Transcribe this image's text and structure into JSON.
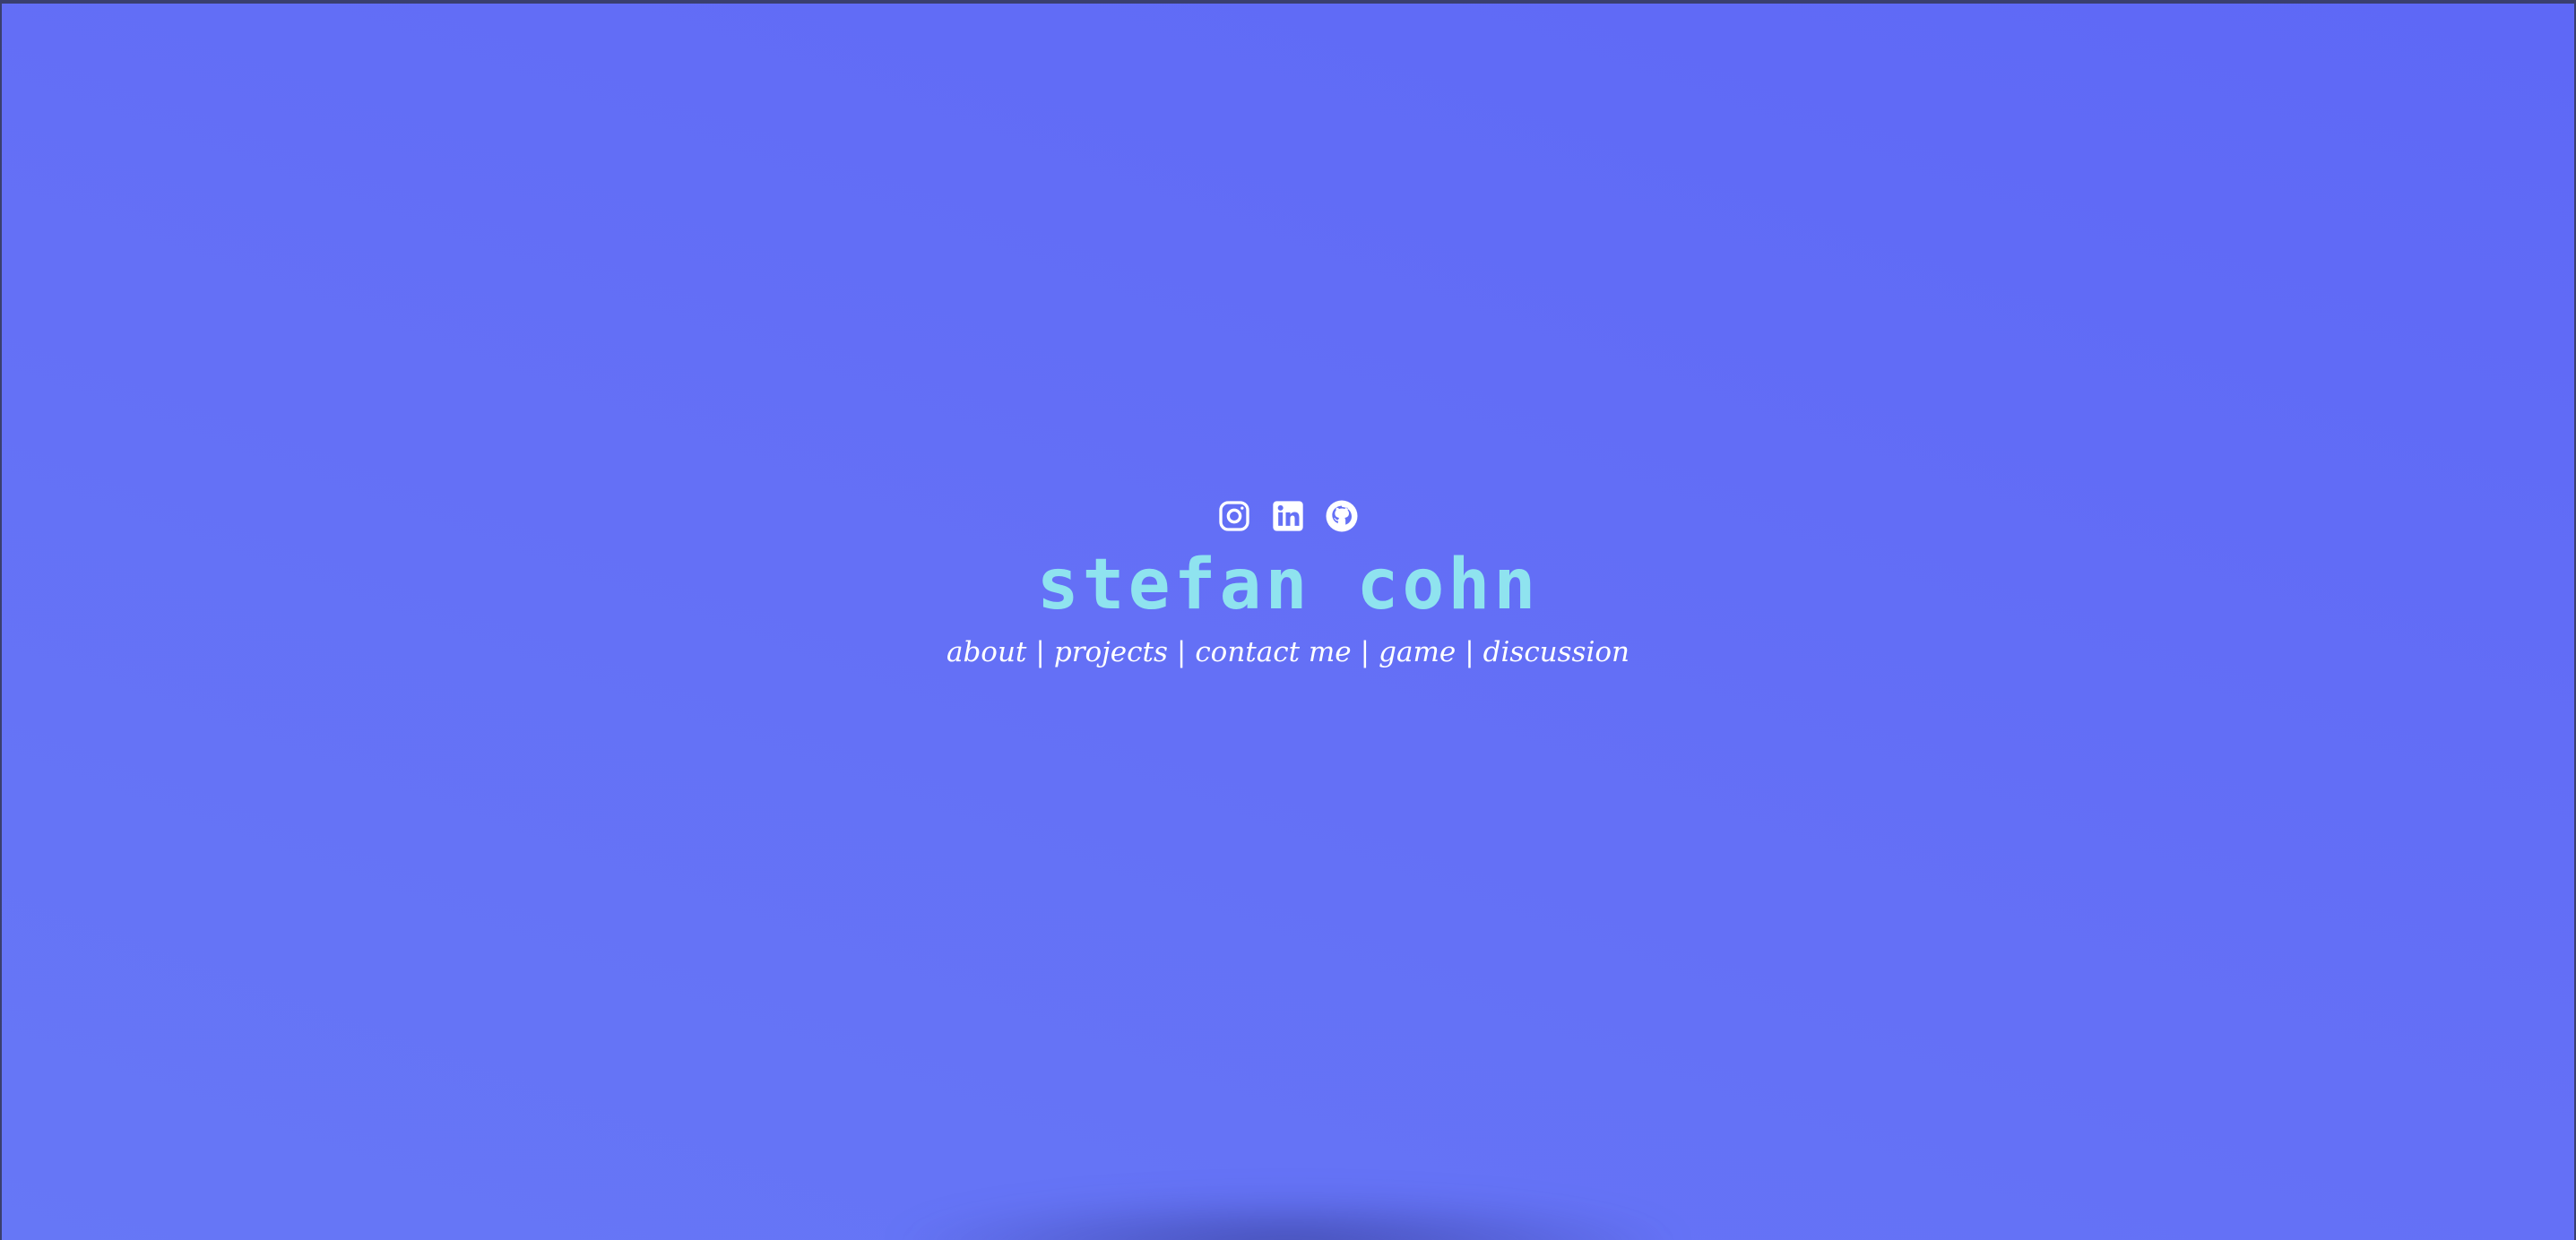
{
  "site": {
    "title": "stefan cohn"
  },
  "socials": [
    {
      "icon": "instagram-icon"
    },
    {
      "icon": "linkedin-icon"
    },
    {
      "icon": "github-icon"
    }
  ],
  "nav": {
    "items": [
      "about",
      "projects",
      "contact me",
      "game",
      "discussion"
    ],
    "separator": "|"
  },
  "colors": {
    "background": "#6370f6",
    "title": "#8fe3ef",
    "nav_text": "#ffffff"
  }
}
